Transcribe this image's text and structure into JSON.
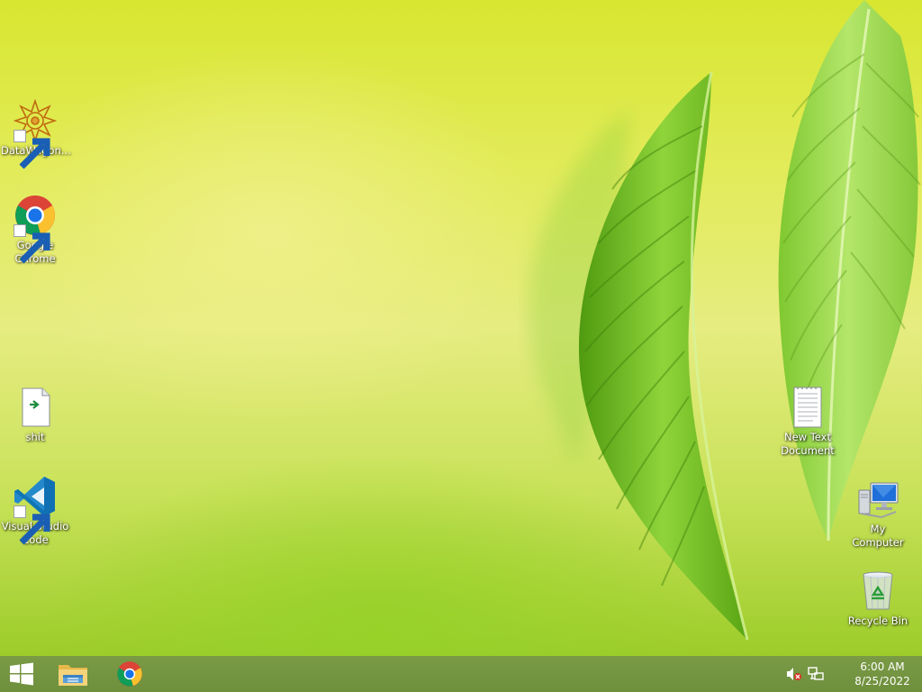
{
  "desktop": {
    "icons": [
      {
        "label": "DataWagon...",
        "icon": "datawagon-icon"
      },
      {
        "label": "Google Chrome",
        "icon": "chrome-icon"
      },
      {
        "label": "shit",
        "icon": "file-icon"
      },
      {
        "label": "Visual Studio Code",
        "icon": "vscode-icon"
      },
      {
        "label": "New Text Document",
        "icon": "text-document-icon"
      },
      {
        "label": "My Computer",
        "icon": "computer-icon"
      },
      {
        "label": "Recycle Bin",
        "icon": "recycle-bin-icon"
      }
    ]
  },
  "taskbar": {
    "start": {
      "icon": "windows-logo-icon"
    },
    "pinned": [
      {
        "icon": "file-explorer-icon"
      },
      {
        "icon": "chrome-icon"
      }
    ],
    "tray": [
      {
        "icon": "volume-muted-icon"
      },
      {
        "icon": "network-icon"
      }
    ],
    "clock": {
      "time": "6:00 AM",
      "date": "8/25/2022"
    }
  },
  "colors": {
    "wallpaper_top": "#d8e630",
    "wallpaper_bottom": "#9ccc2a",
    "taskbar": "#6e8f3c",
    "leaf": "#7ac21e"
  }
}
